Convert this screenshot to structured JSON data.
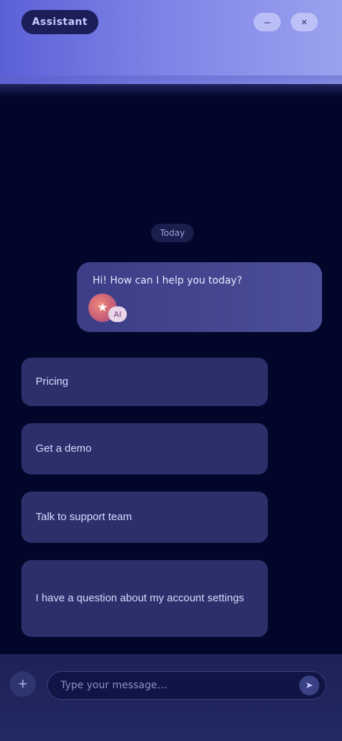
{
  "header": {
    "brand": "Assistant",
    "actions": [
      {
        "name": "minimize-button",
        "icon": "minus-icon",
        "glyph": "–"
      },
      {
        "name": "close-button",
        "icon": "close-icon",
        "glyph": "×"
      }
    ]
  },
  "chat": {
    "date_chip": "Today",
    "bot_message": {
      "text": "Hi! How can I help you today?",
      "avatar_glyph": "★",
      "badge_glyph": "AI"
    },
    "options": [
      {
        "label": "Pricing"
      },
      {
        "label": "Get a demo"
      },
      {
        "label": "Talk to support team"
      },
      {
        "label": "I have a question about my account settings"
      }
    ]
  },
  "composer": {
    "attach_glyph": "+",
    "placeholder": "Type your message…",
    "send_glyph": "➤"
  },
  "colors": {
    "header_start": "#5c60d8",
    "header_end": "#9aa2ee",
    "background": "#02062a",
    "bubble": "#4b4e98",
    "option": "#2b2f6a",
    "composer": "#232a62"
  }
}
